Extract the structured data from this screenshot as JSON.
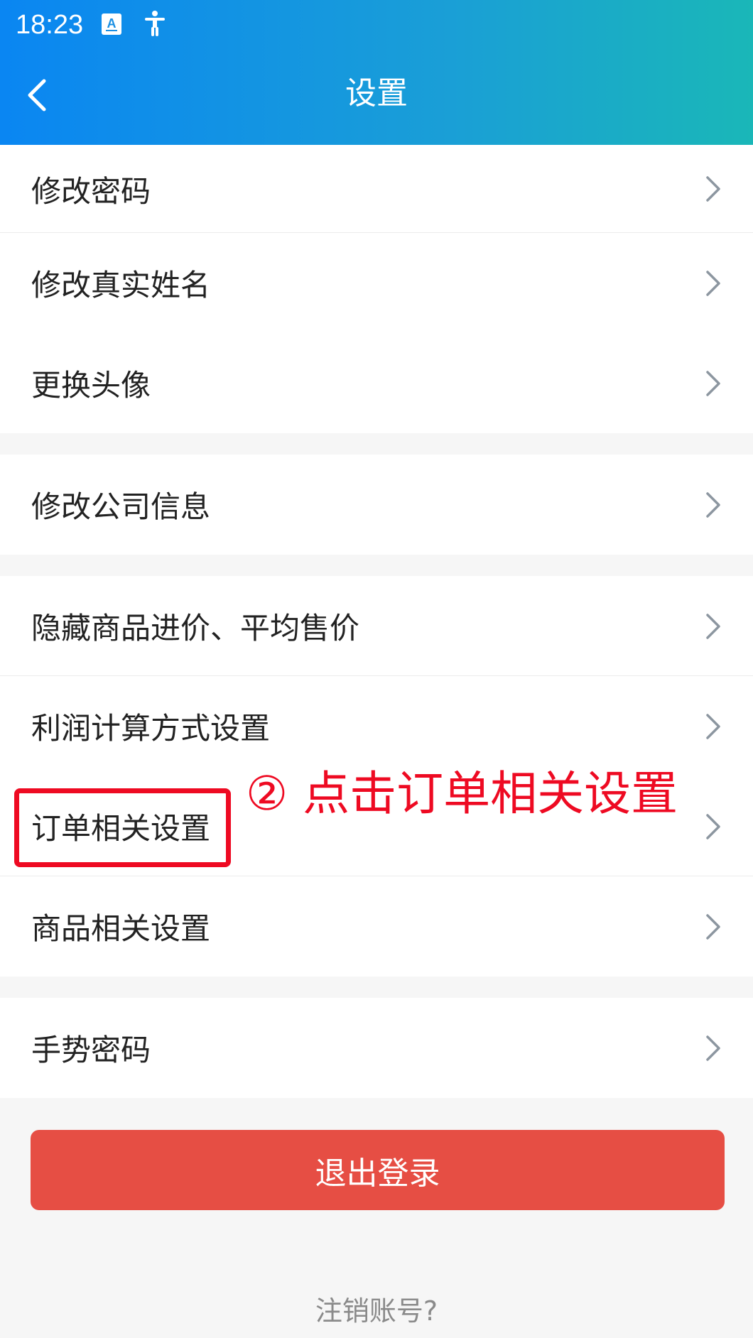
{
  "status_bar": {
    "time": "18:23",
    "icons": [
      "app-notification-icon",
      "accessibility-icon"
    ]
  },
  "nav": {
    "title": "设置",
    "back_icon": "chevron-left-icon"
  },
  "groups": [
    {
      "items": [
        {
          "label": "修改密码"
        },
        {
          "label": "修改真实姓名"
        },
        {
          "label": "更换头像"
        }
      ]
    },
    {
      "items": [
        {
          "label": "修改公司信息"
        }
      ]
    },
    {
      "items": [
        {
          "label": "隐藏商品进价、平均售价"
        },
        {
          "label": "利润计算方式设置"
        },
        {
          "label": "订单相关设置"
        },
        {
          "label": "商品相关设置"
        }
      ]
    },
    {
      "items": [
        {
          "label": "手势密码"
        }
      ]
    }
  ],
  "logout_button": "退出登录",
  "cancel_account_link": "注销账号?",
  "annotation": {
    "text": "② 点击订单相关设置",
    "color": "#ee0a22"
  },
  "colors": {
    "header_start": "#0a86f2",
    "header_end": "#1ab7b8",
    "logout": "#e64e44",
    "chevron": "#8c96a0"
  }
}
